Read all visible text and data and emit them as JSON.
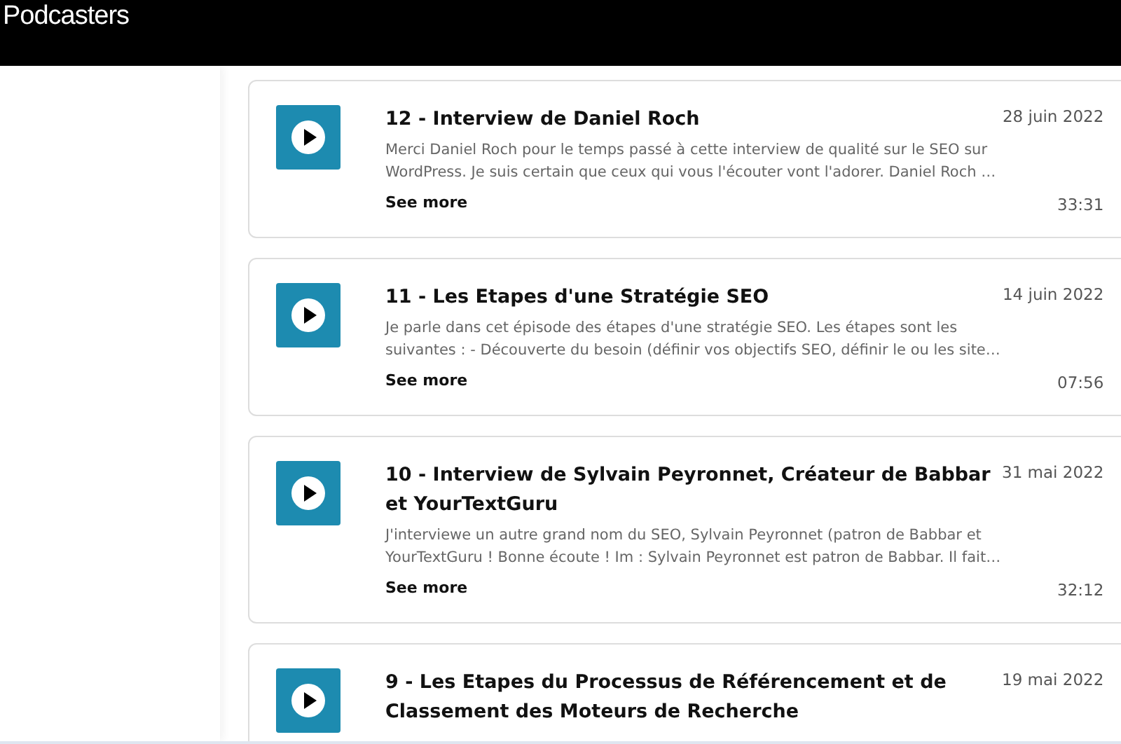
{
  "header": {
    "title": "Podcasters"
  },
  "episodes": [
    {
      "title": "12 - Interview de Daniel Roch",
      "date": "28 juin 2022",
      "description": "Merci Daniel Roch pour le temps passé à cette interview de qualité sur le SEO sur WordPress. Je suis certain que ceux qui vous l'écouter vont l'adorer. Daniel Roch …",
      "link": "See more",
      "duration": "33:31"
    },
    {
      "title": "11 - Les Etapes d'une Stratégie SEO",
      "date": "14 juin 2022",
      "description": "Je parle dans cet épisode des étapes d'une stratégie SEO. Les étapes sont les suivantes :  - Découverte du besoin (définir vos objectifs SEO, définir le ou les site…",
      "link": "See more",
      "duration": "07:56"
    },
    {
      "title": "10 - Interview de Sylvain Peyronnet, Créateur de Babbar et YourTextGuru",
      "date": "31 mai 2022",
      "description": "J'interviewe un autre grand nom du SEO, Sylvain Peyronnet (patron de Babbar et YourTextGuru ! Bonne écoute ! Im : Sylvain Peyronnet est patron de Babbar. Il fait…",
      "link": "See more",
      "duration": "32:12"
    },
    {
      "title": "9 - Les Etapes du Processus de Référencement et de Classement des Moteurs de Recherche",
      "date": "19 mai 2022"
    }
  ]
}
